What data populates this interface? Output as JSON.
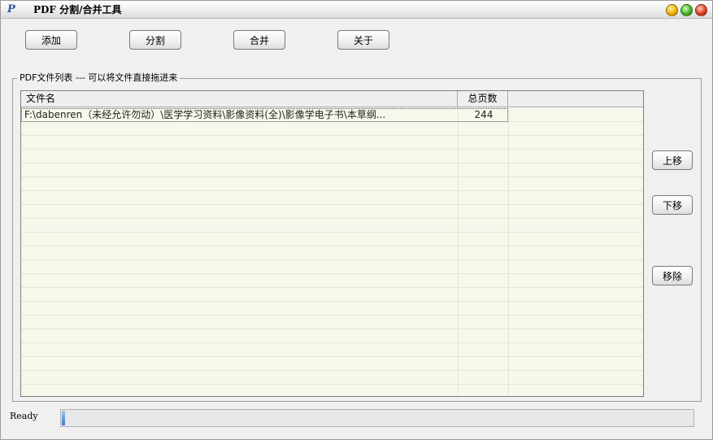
{
  "window": {
    "title": "PDF 分割/合并工具",
    "icon": "pdf-app-icon",
    "icon_glyph": "P"
  },
  "toolbar": {
    "add_label": "添加",
    "split_label": "分割",
    "merge_label": "合并",
    "about_label": "关于"
  },
  "group": {
    "legend": "PDF文件列表  --- 可以将文件直接拖进来"
  },
  "list": {
    "columns": [
      "文件名",
      "总页数"
    ],
    "rows": [
      {
        "name": "F:\\dabenren（未经允许勿动）\\医学学习资料\\影像资料(全)\\影像学电子书\\本草纲...",
        "pages": "244"
      }
    ]
  },
  "side_buttons": {
    "up_label": "上移",
    "down_label": "下移",
    "remove_label": "移除"
  },
  "status": {
    "text": "Ready",
    "progress": 0.005
  },
  "colors": {
    "list_background": "#f7f7ec",
    "progress_fill": "#3a7ad0"
  }
}
